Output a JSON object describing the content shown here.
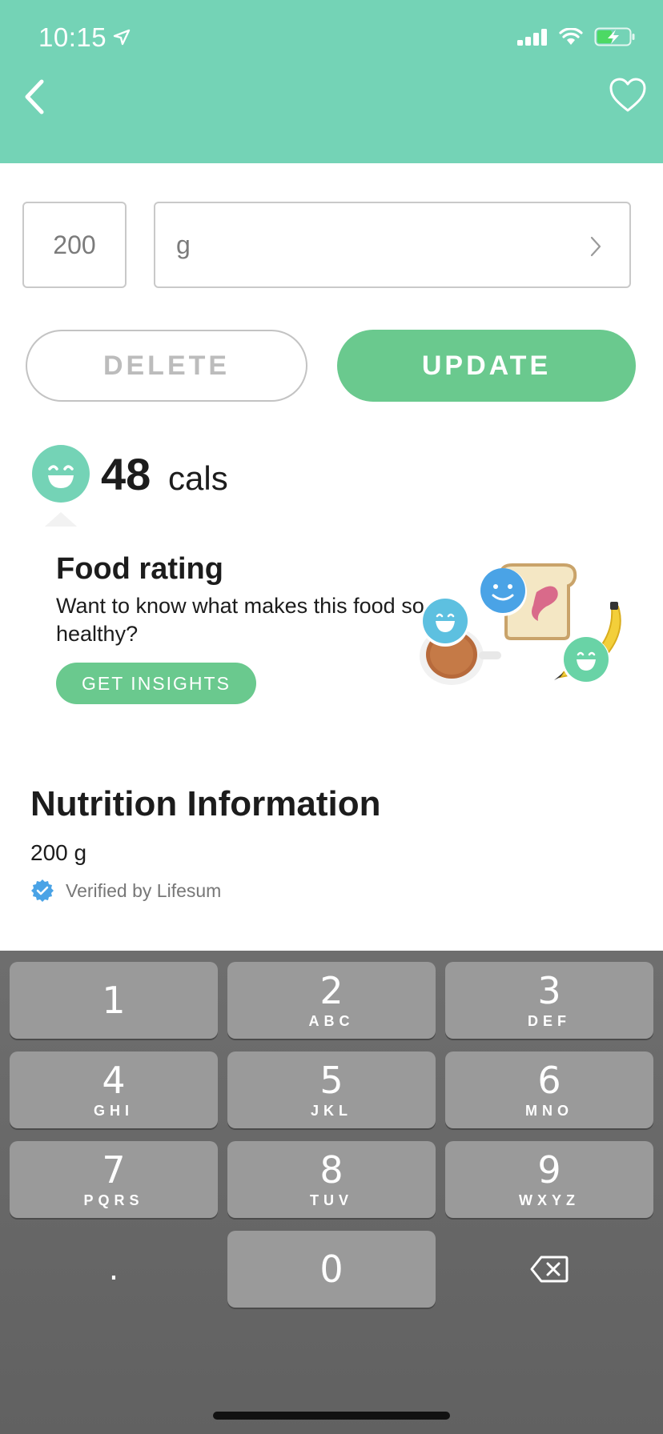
{
  "status_bar": {
    "time": "10:15",
    "icons": [
      "location-arrow-icon",
      "signal-icon",
      "wifi-icon",
      "battery-charging-icon"
    ]
  },
  "header": {
    "background_color": "#74d3b6",
    "back_icon": "chevron-left-icon",
    "favorite_icon": "heart-outline-icon"
  },
  "serving": {
    "quantity": "200",
    "unit": "g"
  },
  "actions": {
    "delete_label": "DELETE",
    "update_label": "UPDATE",
    "accent_color": "#6ac98e"
  },
  "calories": {
    "value": "48",
    "unit": "cals"
  },
  "food_rating": {
    "title": "Food rating",
    "description": "Want to know what makes this food so healthy?",
    "button_label": "GET INSIGHTS"
  },
  "nutrition": {
    "title": "Nutrition Information",
    "amount": "200  g",
    "verified_label": "Verified by Lifesum"
  },
  "keypad": {
    "keys": [
      {
        "num": "1",
        "letters": ""
      },
      {
        "num": "2",
        "letters": "ABC"
      },
      {
        "num": "3",
        "letters": "DEF"
      },
      {
        "num": "4",
        "letters": "GHI"
      },
      {
        "num": "5",
        "letters": "JKL"
      },
      {
        "num": "6",
        "letters": "MNO"
      },
      {
        "num": "7",
        "letters": "PQRS"
      },
      {
        "num": "8",
        "letters": "TUV"
      },
      {
        "num": "9",
        "letters": "WXYZ"
      },
      {
        "num": ".",
        "letters": ""
      },
      {
        "num": "0",
        "letters": ""
      }
    ],
    "delete_icon": "backspace-icon"
  }
}
